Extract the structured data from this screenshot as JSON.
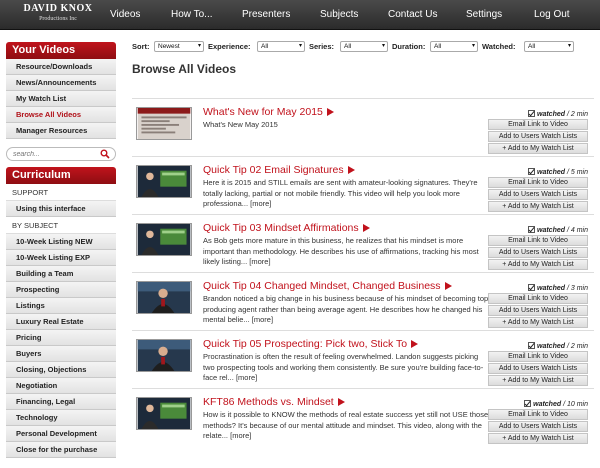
{
  "logo": {
    "line1": "DAVID KNOX",
    "line2": "Productions Inc"
  },
  "nav": [
    "Videos",
    "How To...",
    "Presenters",
    "Subjects",
    "Contact Us",
    "Settings",
    "Log Out"
  ],
  "sidebar": {
    "your_videos_header": "Your Videos",
    "your_videos": [
      "Resource/Downloads",
      "News/Announcements",
      "My Watch List",
      "Browse All Videos",
      "Manager Resources"
    ],
    "search_placeholder": "search...",
    "curriculum_header": "Curriculum",
    "support_label": "SUPPORT",
    "support_items": [
      "Using this interface"
    ],
    "by_subject_label": "BY SUBJECT",
    "subjects": [
      "10-Week Listing NEW",
      "10-Week Listing EXP",
      "Building a Team",
      "Prospecting",
      "Listings",
      "Luxury Real Estate",
      "Pricing",
      "Buyers",
      "Closing, Objections",
      "Negotiation",
      "Financing, Legal",
      "Technology",
      "Personal Development",
      "Close for the purchase"
    ]
  },
  "filters": {
    "sort_label": "Sort:",
    "sort_value": "Newest",
    "experience_label": "Experience:",
    "experience_value": "All",
    "series_label": "Series:",
    "series_value": "All",
    "duration_label": "Duration:",
    "duration_value": "All",
    "watched_label": "Watched:",
    "watched_value": "All"
  },
  "page_title": "Browse All Videos",
  "buttons": {
    "email": "Email Link to Video",
    "add_users": "Add to Users Watch Lists",
    "add_mine": "+ Add to My Watch List"
  },
  "watched_label": "watched",
  "more_label": "[more]",
  "videos": [
    {
      "title": "What's New for May 2015",
      "desc": "What's New May 2015",
      "duration": "/ 2 min",
      "more": false,
      "thumb": "slide"
    },
    {
      "title": "Quick Tip 02 Email Signatures",
      "desc": "Here it is 2015 and STILL emails are sent with amateur-looking signatures. They're totally lacking, partial or not mobile friendly. This video will help you look more professiona...",
      "duration": "/ 5 min",
      "more": true,
      "thumb": "presenter"
    },
    {
      "title": "Quick Tip 03 Mindset Affirmations",
      "desc": "As Bob gets more mature in this business, he realizes that his mindset is more important than methodology. He describes his use of affirmations, tracking his most likely listing...",
      "duration": "/ 4 min",
      "more": true,
      "thumb": "presenter"
    },
    {
      "title": "Quick Tip 04 Changed Mindset, Changed Business",
      "desc": "Brandon noticed a big change in his business because of his mindset of becoming top producing agent rather than being average agent. He describes how he changed his mental belie...",
      "duration": "/ 3 min",
      "more": true,
      "thumb": "presenter2"
    },
    {
      "title": "Quick Tip 05 Prospecting: Pick two, Stick To",
      "desc": "Procrastination is often the result of feeling overwhelmed. Landon suggests picking two prospecting tools and working them consistently. Be sure you're building face-to-face rel...",
      "duration": "/ 2 min",
      "more": true,
      "thumb": "presenter2"
    },
    {
      "title": "KFT86 Methods vs. Mindset",
      "desc": "How is it possible to KNOW the methods of real estate success yet still not USE those methods? It's because of our mental attitude and mindset. This video, along with the relate...",
      "duration": "/ 10 min",
      "more": true,
      "thumb": "presenter"
    }
  ]
}
